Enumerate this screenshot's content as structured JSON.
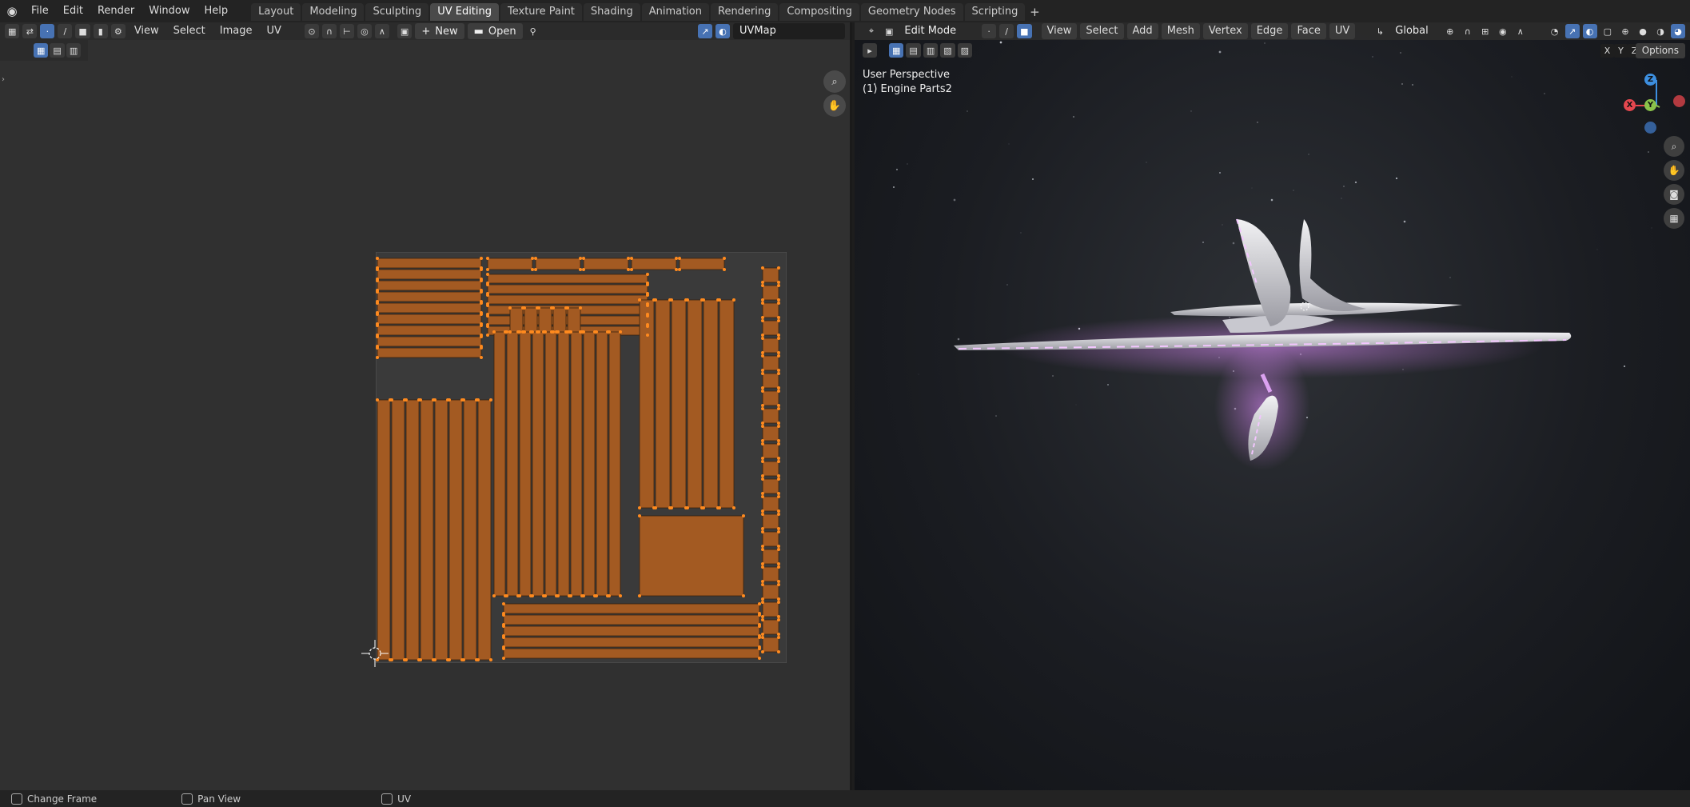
{
  "topbar": {
    "menus": [
      "File",
      "Edit",
      "Render",
      "Window",
      "Help"
    ],
    "workspace_tabs": [
      "Layout",
      "Modeling",
      "Sculpting",
      "UV Editing",
      "Texture Paint",
      "Shading",
      "Animation",
      "Rendering",
      "Compositing",
      "Geometry Nodes",
      "Scripting"
    ],
    "active_tab": "UV Editing"
  },
  "uv_editor": {
    "menus": [
      "View",
      "Select",
      "Image",
      "UV"
    ],
    "new_label": "New",
    "open_label": "Open",
    "uvmap_value": "UVMap"
  },
  "viewport": {
    "mode": "Edit Mode",
    "menus": [
      "View",
      "Select",
      "Add",
      "Mesh",
      "Vertex",
      "Edge",
      "Face",
      "UV"
    ],
    "orientation": "Global",
    "perspective_label": "User Perspective",
    "object_label": "(1) Engine Parts2",
    "axis_x": "X",
    "axis_y": "Y",
    "axis_z": "Z",
    "options_label": "Options",
    "gizmo_x": "X",
    "gizmo_y": "Y",
    "gizmo_z": "Z",
    "colors": {
      "x": "#e5474f",
      "y": "#8bc34a",
      "z": "#3d8fe0"
    }
  },
  "statusbar": {
    "items": [
      "Change Frame",
      "Pan View",
      "UV"
    ]
  },
  "colors": {
    "accent": "#4772b3",
    "uv_fill": "#a35a22",
    "uv_vertex": "#ff8a1e"
  }
}
